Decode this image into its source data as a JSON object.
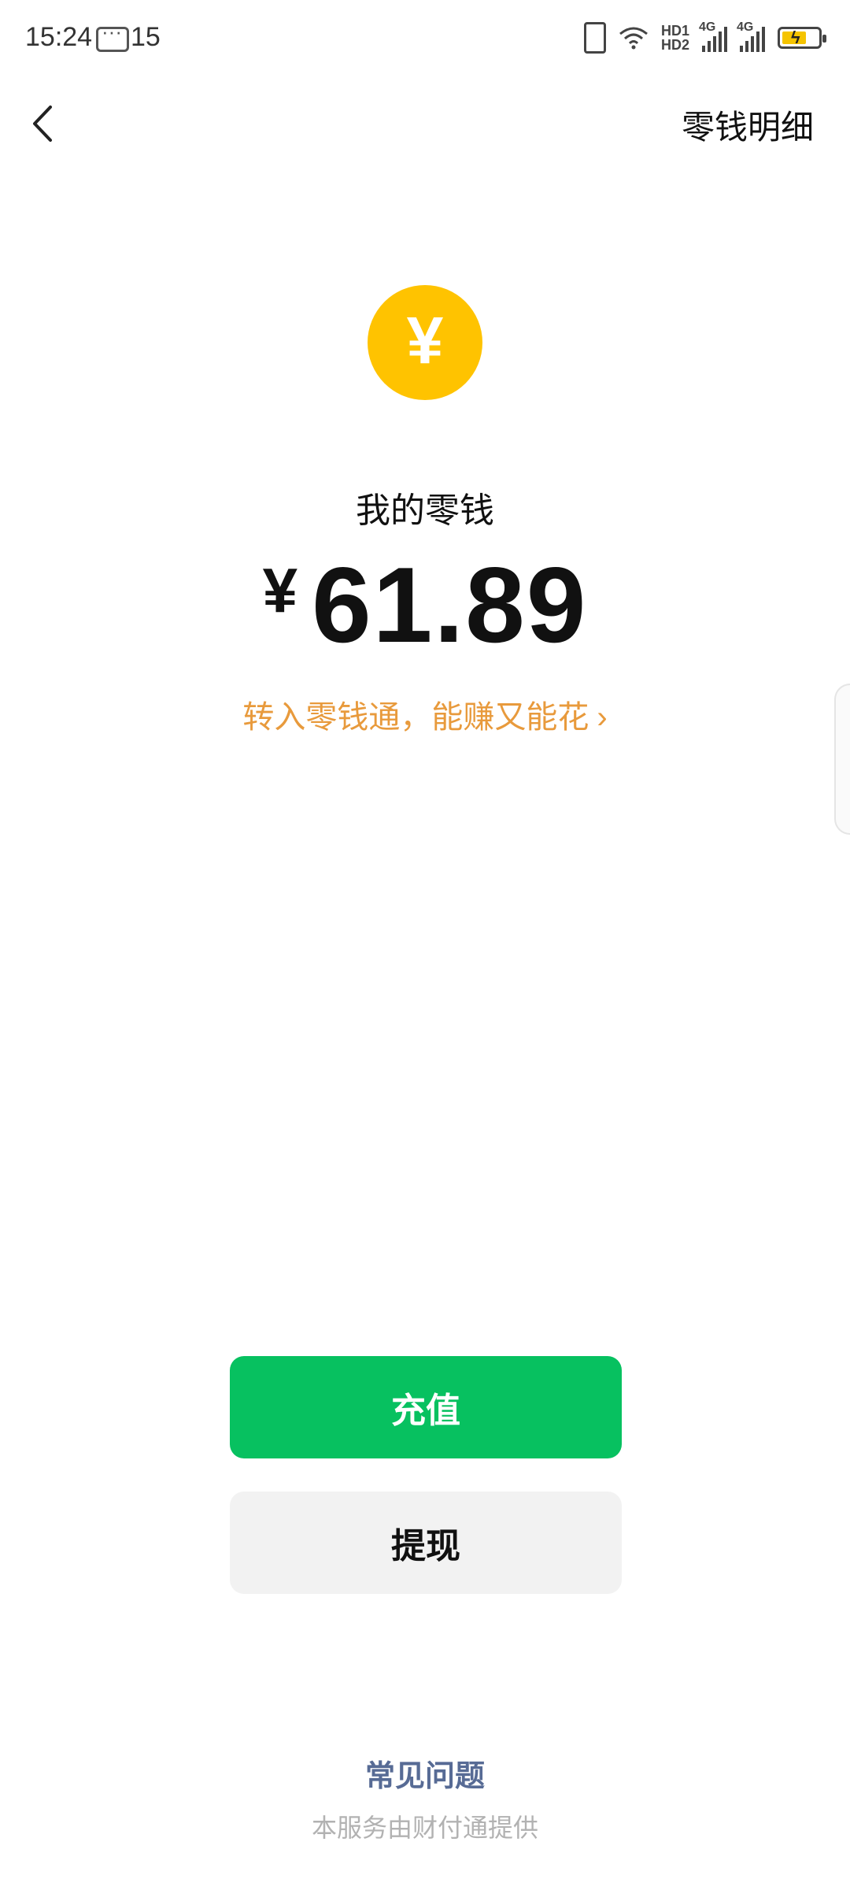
{
  "status_bar": {
    "time": "15:24",
    "notification_count": "15",
    "hd1": "HD1",
    "hd2": "HD2",
    "network1": "4G",
    "network2": "4G"
  },
  "header": {
    "detail_link": "零钱明细"
  },
  "coin_icon": {
    "symbol": "¥",
    "color": "#ffc300"
  },
  "balance": {
    "label": "我的零钱",
    "currency": "¥",
    "amount": "61.89"
  },
  "promo": {
    "text": "转入零钱通，能赚又能花",
    "chevron": "›",
    "color": "#e89a3c"
  },
  "actions": {
    "recharge_label": "充值",
    "withdraw_label": "提现",
    "primary_color": "#07c160"
  },
  "footer": {
    "faq": "常见问题",
    "provider": "本服务由财付通提供"
  }
}
